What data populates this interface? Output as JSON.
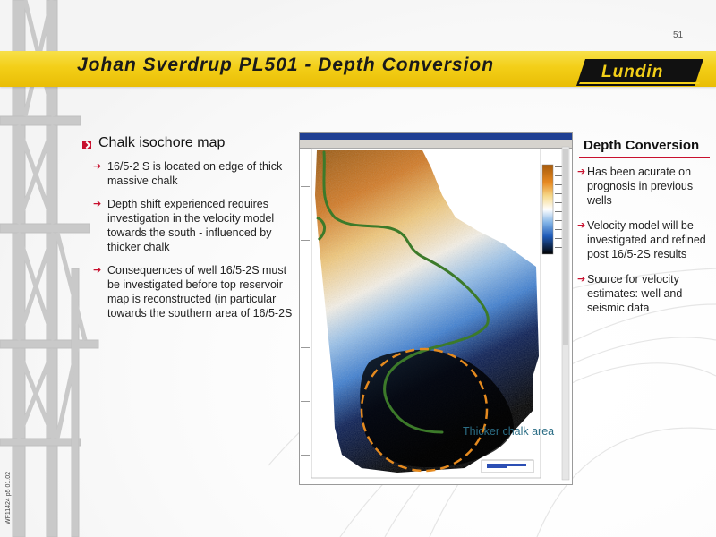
{
  "slide": {
    "page_number": "51",
    "title": "Johan Sverdrup PL501 - Depth Conversion",
    "logo_text": "Lundin",
    "footer_code": "WF11424 p5 01.02"
  },
  "left_section": {
    "heading": "Chalk isochore map",
    "bullets": [
      "16/5-2 S is located on edge of thick massive chalk",
      "Depth shift experienced requires investigation in the velocity model towards the south - influenced by thicker chalk",
      "Consequences of well 16/5-2S must be investigated before top reservoir map is reconstructed (in particular towards the southern area of 16/5-2S"
    ]
  },
  "right_section": {
    "heading": "Depth Conversion",
    "bullets": [
      "Has been acurate on prognosis in previous wells",
      "Velocity model will be investigated and refined post 16/5-2S results",
      "Source for velocity estimates: well and seismic data"
    ]
  },
  "map": {
    "callout_label": "Thicker chalk area"
  },
  "colors": {
    "accent_yellow": "#f3cf18",
    "accent_red": "#c8102e",
    "contour_green": "#3c7a2a",
    "callout_orange": "#e58a1f",
    "callout_text": "#2c6e86"
  },
  "icons": {
    "heading_bullet": "red-square-arrow-icon",
    "list_bullet": "arrow-right-icon"
  }
}
